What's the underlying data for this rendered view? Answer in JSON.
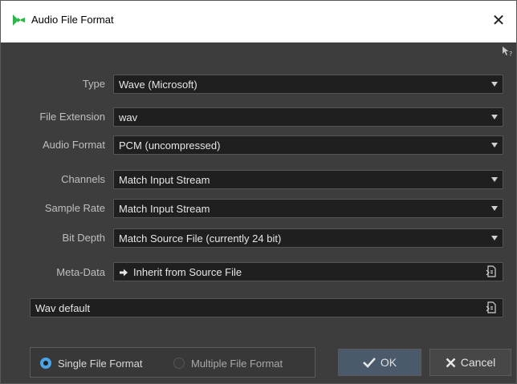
{
  "window": {
    "title": "Audio File Format",
    "close_label": "✕"
  },
  "fields": {
    "type": {
      "label": "Type",
      "value": "Wave (Microsoft)"
    },
    "file_extension": {
      "label": "File Extension",
      "value": "wav"
    },
    "audio_format": {
      "label": "Audio Format",
      "value": "PCM (uncompressed)"
    },
    "channels": {
      "label": "Channels",
      "value": "Match Input Stream"
    },
    "sample_rate": {
      "label": "Sample Rate",
      "value": "Match Input Stream"
    },
    "bit_depth": {
      "label": "Bit Depth",
      "value": "Match Source File (currently 24 bit)"
    },
    "meta_data": {
      "label": "Meta-Data",
      "value": "Inherit from Source File"
    }
  },
  "preset": {
    "value": "Wav default"
  },
  "format_mode": {
    "single_label": "Single File Format",
    "multiple_label": "Multiple File Format",
    "selected": "single"
  },
  "buttons": {
    "ok_label": "OK",
    "cancel_label": "Cancel"
  },
  "colors": {
    "accent": "#4aa3e6",
    "background": "#3d3d3d",
    "field_bg": "#1f1f1f",
    "logo_green": "#2fb34a"
  }
}
